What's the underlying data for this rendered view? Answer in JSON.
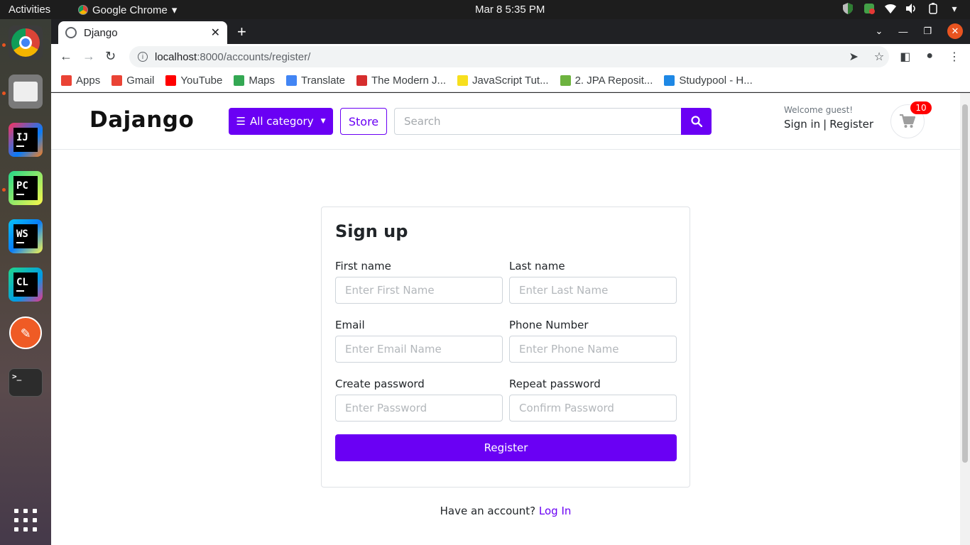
{
  "system": {
    "activities": "Activities",
    "app_name": "Google Chrome",
    "clock": "Mar 8   5:35 PM"
  },
  "browser": {
    "tab_title": "Django",
    "url_host": "localhost",
    "url_path": ":8000/accounts/register/",
    "bookmarks": [
      {
        "label": "Apps",
        "icon": "apps-grid-icon",
        "color": "#ea4335"
      },
      {
        "label": "Gmail",
        "icon": "gmail-icon",
        "color": "#ea4335"
      },
      {
        "label": "YouTube",
        "icon": "youtube-icon",
        "color": "#ff0000"
      },
      {
        "label": "Maps",
        "icon": "maps-pin-icon",
        "color": "#34a853"
      },
      {
        "label": "Translate",
        "icon": "translate-icon",
        "color": "#4285f4"
      },
      {
        "label": "The Modern J...",
        "icon": "modern-js-icon",
        "color": "#d62d2d"
      },
      {
        "label": "JavaScript Tut...",
        "icon": "js-icon",
        "color": "#f7df1e"
      },
      {
        "label": "2. JPA Reposit...",
        "icon": "spring-leaf-icon",
        "color": "#6db33f"
      },
      {
        "label": "Studypool - H...",
        "icon": "studypool-icon",
        "color": "#1e88e5"
      }
    ]
  },
  "site": {
    "logo": "Dajango",
    "category_button": "All category",
    "store_button": "Store",
    "search_placeholder": "Search",
    "welcome": "Welcome guest!",
    "sign_in": "Sign in",
    "separator": "|",
    "register": "Register",
    "cart_count": "10",
    "accent_color": "#6a00f4"
  },
  "form": {
    "title": "Sign up",
    "first_name_label": "First name",
    "first_name_placeholder": "Enter First Name",
    "last_name_label": "Last name",
    "last_name_placeholder": "Enter Last Name",
    "email_label": "Email",
    "email_placeholder": "Enter Email Name",
    "phone_label": "Phone Number",
    "phone_placeholder": "Enter Phone Name",
    "password_label": "Create password",
    "password_placeholder": "Enter Password",
    "repeat_label": "Repeat password",
    "repeat_placeholder": "Confirm Password",
    "submit": "Register",
    "have_account": "Have an account?",
    "login_link": "Log In"
  }
}
